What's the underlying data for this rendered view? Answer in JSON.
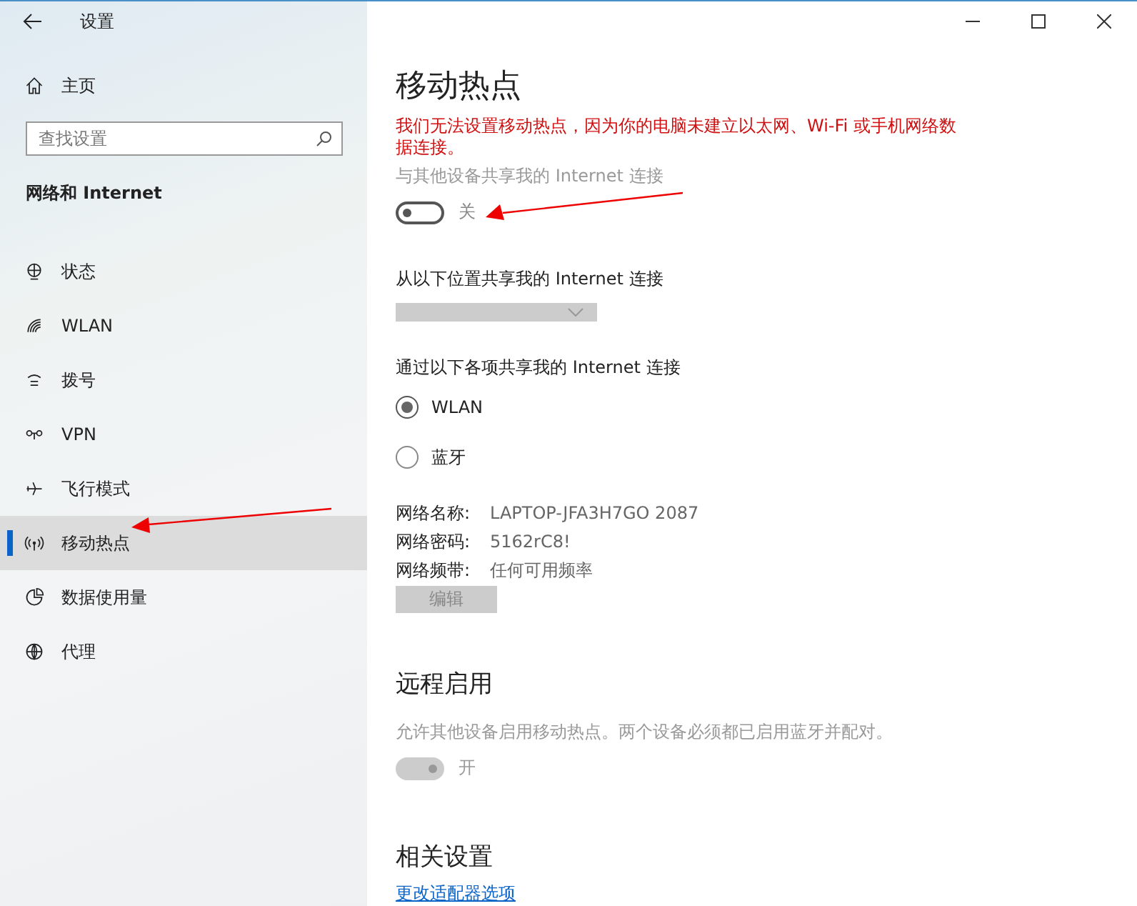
{
  "window": {
    "title": "设置"
  },
  "sidebar": {
    "home": "主页",
    "search": {
      "placeholder": "查找设置"
    },
    "section": "网络和 Internet",
    "items": [
      {
        "label": "状态",
        "selected": false
      },
      {
        "label": "WLAN",
        "selected": false
      },
      {
        "label": "拨号",
        "selected": false
      },
      {
        "label": "VPN",
        "selected": false
      },
      {
        "label": "飞行模式",
        "selected": false
      },
      {
        "label": "移动热点",
        "selected": true
      },
      {
        "label": "数据使用量",
        "selected": false
      },
      {
        "label": "代理",
        "selected": false
      }
    ]
  },
  "page": {
    "title": "移动热点",
    "error": "我们无法设置移动热点，因为你的电脑未建立以太网、Wi-Fi 或手机网络数据连接。",
    "share_toggle": {
      "label": "与其他设备共享我的 Internet 连接",
      "state": "关",
      "on": false,
      "disabled": false
    },
    "share_from": {
      "label": "从以下位置共享我的 Internet 连接",
      "disabled": true
    },
    "share_over": {
      "label": "通过以下各项共享我的 Internet 连接",
      "options": [
        {
          "label": "WLAN",
          "selected": true
        },
        {
          "label": "蓝牙",
          "selected": false
        }
      ]
    },
    "info": [
      {
        "label": "网络名称:",
        "value": "LAPTOP-JFA3H7GO 2087"
      },
      {
        "label": "网络密码:",
        "value": "5162rC8!"
      },
      {
        "label": "网络频带:",
        "value": "任何可用频率"
      }
    ],
    "edit_button": {
      "label": "编辑",
      "disabled": true
    },
    "remote": {
      "title": "远程启用",
      "description": "允许其他设备启用移动热点。两个设备必须都已启用蓝牙并配对。",
      "state": "开",
      "on": true,
      "disabled": true
    },
    "related": {
      "title": "相关设置",
      "link": "更改适配器选项"
    }
  }
}
